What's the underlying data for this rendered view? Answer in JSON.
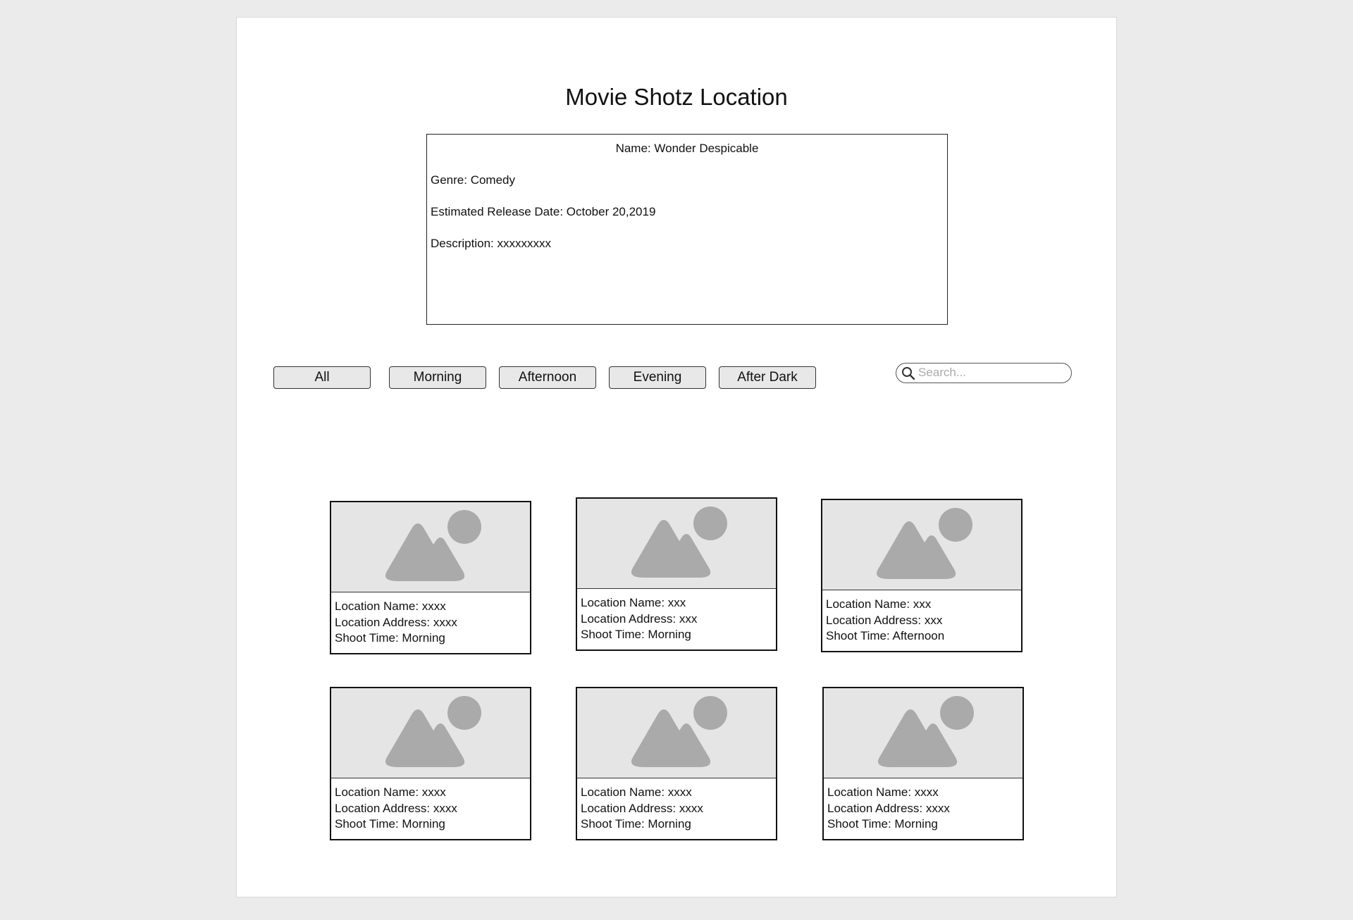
{
  "page": {
    "title": "Movie Shotz Location"
  },
  "movie": {
    "name": "Name: Wonder Despicable",
    "genre": "Genre: Comedy",
    "release": "Estimated Release Date: October 20,2019",
    "description": "Description: xxxxxxxxx"
  },
  "filters": [
    "All",
    "Morning",
    "Afternoon",
    "Evening",
    "After Dark"
  ],
  "search": {
    "placeholder": "Search...",
    "value": ""
  },
  "icons": {
    "search": "search-icon",
    "image_placeholder": "image-placeholder-icon"
  },
  "colors": {
    "background": "#ebebeb",
    "image_placeholder": "#e5e5e5",
    "image_glyph": "#aaaaaa"
  },
  "locations": [
    {
      "name": "Location Name: xxxx",
      "address": "Location Address: xxxx",
      "shoot_time": "Shoot Time: Morning"
    },
    {
      "name": "Location Name: xxx",
      "address": "Location Address: xxx",
      "shoot_time": "Shoot Time: Morning"
    },
    {
      "name": "Location Name: xxx",
      "address": "Location Address: xxx",
      "shoot_time": "Shoot Time: Afternoon"
    },
    {
      "name": "Location Name: xxxx",
      "address": "Location Address: xxxx",
      "shoot_time": "Shoot Time: Morning"
    },
    {
      "name": "Location Name: xxxx",
      "address": "Location Address: xxxx",
      "shoot_time": "Shoot Time: Morning"
    },
    {
      "name": "Location Name: xxxx",
      "address": "Location Address: xxxx",
      "shoot_time": "Shoot Time: Morning"
    }
  ]
}
